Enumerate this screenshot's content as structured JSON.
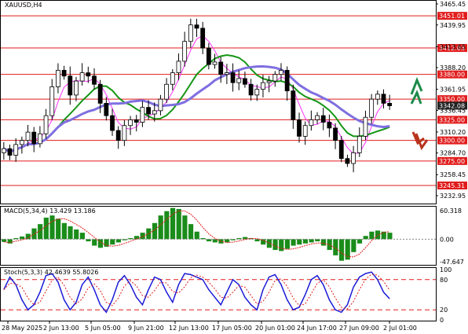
{
  "title": "XAUUSD,H4",
  "main": {
    "ylim": [
      3232.95,
      3465.45
    ],
    "tick_labels": [
      "3465.45",
      "3439.95",
      "3413.65",
      "3388.20",
      "3361.95",
      "3336.45",
      "3310.20",
      "3284.70",
      "3258.45",
      "3232.95"
    ],
    "levels": [
      {
        "value": 3451.01,
        "label": "3451.01"
      },
      {
        "value": 3412.03,
        "label": "3412.03"
      },
      {
        "value": 3380.0,
        "label": "3380.00"
      },
      {
        "value": 3350.0,
        "label": "3350.00"
      },
      {
        "value": 3325.0,
        "label": "3325.00"
      },
      {
        "value": 3300.0,
        "label": "3300.00"
      },
      {
        "value": 3275.0,
        "label": "3275.00"
      },
      {
        "value": 3245.31,
        "label": "3245.31"
      }
    ],
    "current_price": "3342.08",
    "colors": {
      "level": "#e11c1c",
      "candle": "#000000",
      "ma_fast": "#ff33ff",
      "ma_mid": "#159615",
      "ma_slow": "#7f6fe0",
      "arrow_up": "#1e8a4a",
      "arrow_down": "#b8331c",
      "price_tag": "#222222"
    }
  },
  "macd": {
    "label": "MACD(5,34,4) 13.429 13.186",
    "tick_labels": [
      "60.318",
      "0.00",
      "-47.647"
    ],
    "ylim": [
      -47.647,
      60.318
    ]
  },
  "stoch": {
    "label": "Stoch(5,3,3) 42.4639 55.8026",
    "tick_labels": [
      "100",
      "80",
      "20",
      "0"
    ]
  },
  "x_labels": [
    "28 May 2025",
    "2 Jun 13:00",
    "5 Jun 05:00",
    "9 Jun 21:00",
    "12 Jun 13:00",
    "17 Jun 05:00",
    "20 Jun 01:00",
    "24 Jun 17:00",
    "27 Jun 09:00",
    "2 Jul 01:00"
  ],
  "chart_data": {
    "type": "line",
    "title": "XAUUSD,H4",
    "series": [
      {
        "name": "close",
        "values": [
          3290,
          3282,
          3295,
          3300,
          3310,
          3296,
          3308,
          3330,
          3365,
          3385,
          3378,
          3355,
          3372,
          3382,
          3378,
          3368,
          3345,
          3330,
          3312,
          3300,
          3318,
          3325,
          3322,
          3340,
          3332,
          3336,
          3350,
          3368,
          3382,
          3396,
          3420,
          3440,
          3436,
          3412,
          3392,
          3395,
          3380,
          3382,
          3370,
          3375,
          3368,
          3355,
          3362,
          3370,
          3372,
          3380,
          3385,
          3360,
          3325,
          3305,
          3318,
          3325,
          3330,
          3322,
          3315,
          3300,
          3278,
          3272,
          3285,
          3305,
          3328,
          3350,
          3356,
          3345,
          3342
        ]
      }
    ],
    "ylim": [
      3232.95,
      3465.45
    ]
  }
}
